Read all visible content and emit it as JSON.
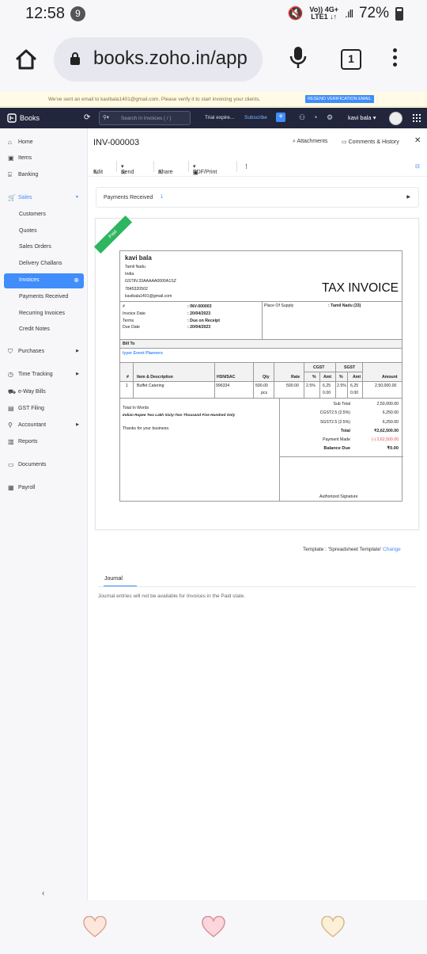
{
  "status_bar": {
    "time": "12:58",
    "notif_count": "9",
    "net_top": "Vo)) 4G+",
    "net_bottom": "LTE1 ↓↑",
    "battery": "72%"
  },
  "browser": {
    "url": "books.zoho.in/app",
    "tabs_count": "1"
  },
  "banner": {
    "message": "We've sent an email to kavibala1401@gmail.com. Please verify it to start invoicing your clients.",
    "button": "RESEND VERIFICATION EMAIL"
  },
  "app_header": {
    "app_name": "Books",
    "search_placeholder": "Search in Invoices ( / )",
    "trial": "Trial expire...",
    "subscribe": "Subscribe",
    "user": "kavi bala"
  },
  "sidebar": {
    "home": "Home",
    "items": "Items",
    "banking": "Banking",
    "sales": "Sales",
    "customers": "Customers",
    "quotes": "Quotes",
    "sales_orders": "Sales Orders",
    "delivery_challans": "Delivery Challans",
    "invoices": "Invoices",
    "payments_received": "Payments Received",
    "recurring_invoices": "Recurring Invoices",
    "credit_notes": "Credit Notes",
    "purchases": "Purchases",
    "time_tracking": "Time Tracking",
    "eway_bills": "e-Way Bills",
    "gst_filing": "GST Filing",
    "accountant": "Accountant",
    "reports": "Reports",
    "documents": "Documents",
    "payroll": "Payroll"
  },
  "invoice_header": {
    "number": "INV-000003",
    "attachments": "Attachments",
    "comments": "Comments & History"
  },
  "toolbar": {
    "edit": "Edit",
    "send": "Send",
    "share": "Share",
    "pdf": "PDF/Print"
  },
  "payments_received": {
    "label": "Payments Received",
    "count": "1"
  },
  "invoice": {
    "ribbon": "Paid",
    "seller_name": "kavi bala",
    "seller_address": [
      "Tamil Nadu",
      "India",
      "GSTIN 33AAAAA0000A1SZ",
      "7845320502",
      "kavibala1401@gmail.com"
    ],
    "title": "TAX INVOICE",
    "meta_labels": [
      "#",
      "Invoice Date",
      "Terms",
      "Due Date"
    ],
    "meta_values": [
      ": INV-000003",
      ": 20/04/2023",
      ": Due on Receipt",
      ": 20/04/2023"
    ],
    "place_of_supply_label": "Place Of Supply",
    "place_of_supply_value": ": Tamil Nadu (33)",
    "bill_to_label": "Bill To",
    "bill_to_name": "Iyyer Event Planners",
    "columns": {
      "num": "#",
      "item": "Item & Description",
      "hsn": "HSN/SAC",
      "qty": "Qty",
      "rate": "Rate",
      "cgst": "CGST",
      "sgst": "SGST",
      "pct": "%",
      "amt": "Amt",
      "amount": "Amount"
    },
    "row": {
      "num": "1",
      "item": "Buffet Catering",
      "hsn": "996334",
      "qty": "500.00",
      "unit": "pcs",
      "rate": "500.00",
      "cgst_pct": "2.5%",
      "cgst_amt": "6,25",
      "cgst_amt2": "0.00",
      "sgst_pct": "2.5%",
      "sgst_amt": "6,25",
      "sgst_amt2": "0.00",
      "amount": "2,50,000.00"
    },
    "total_in_words_label": "Total In Words",
    "total_in_words": "Indian Rupee Two Lakh Sixty-Two Thousand Five Hundred Only",
    "thanks": "Thanks for your business.",
    "summary_labels": [
      "Sub Total",
      "CGST2.5 (2.5%)",
      "SGST2.5 (2.5%)",
      "Total",
      "Payment Made",
      "Balance Due"
    ],
    "summary_values": [
      "2,50,000.00",
      "6,250.00",
      "6,250.00",
      "₹2,62,500.00",
      "(-) 2,62,500.00",
      "₹0.00"
    ],
    "signature": "Authorized Signature"
  },
  "template": {
    "label": "Template : 'Spreadsheet Template'",
    "change": "Change"
  },
  "journal": {
    "tab": "Journal",
    "note": "Journal entries will not be available for Invoices in the Paid state."
  },
  "colors": {
    "accent": "#408dfb",
    "header_bg": "#21263c",
    "paid_ribbon": "#2eb55f",
    "negative": "#e04b4b"
  }
}
